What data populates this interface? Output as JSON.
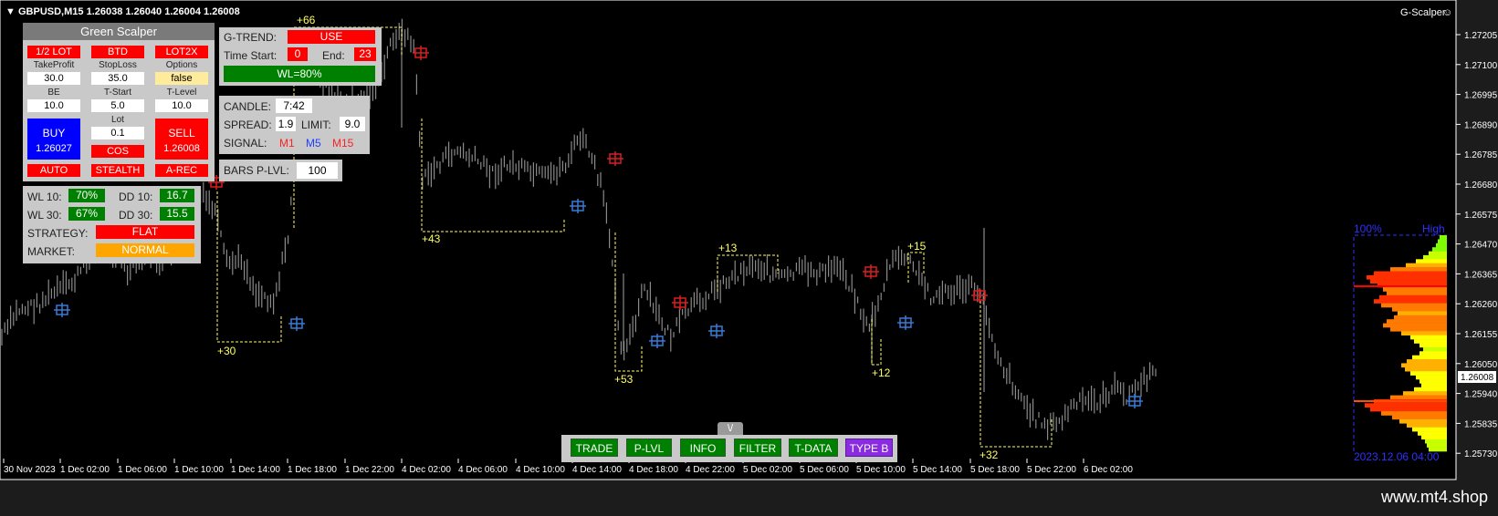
{
  "window": {
    "symbol_line": "GBPUSD,M15  1.26038 1.26040 1.26004 1.26008",
    "indicator_name": "G-Scalper",
    "watermark": "www.mt4.shop",
    "colors": {
      "background": "#000000",
      "candles": "#8a8a8a",
      "profit_text": "#ffff60",
      "buy_marker": "#3a7bd5",
      "sell_marker": "#d82020"
    }
  },
  "price_axis": {
    "labels": [
      "1.27205",
      "1.27100",
      "1.26995",
      "1.26890",
      "1.26785",
      "1.26680",
      "1.26575",
      "1.26470",
      "1.26365",
      "1.26260",
      "1.26155",
      "1.26050",
      "1.25940",
      "1.25835",
      "1.25730"
    ],
    "current_price": "1.26008"
  },
  "time_axis": {
    "labels": [
      "30 Nov 2023",
      "1 Dec 02:00",
      "1 Dec 06:00",
      "1 Dec 10:00",
      "1 Dec 14:00",
      "1 Dec 18:00",
      "1 Dec 22:00",
      "4 Dec 02:00",
      "4 Dec 06:00",
      "4 Dec 10:00",
      "4 Dec 14:00",
      "4 Dec 18:00",
      "4 Dec 22:00",
      "5 Dec 02:00",
      "5 Dec 06:00",
      "5 Dec 10:00",
      "5 Dec 14:00",
      "5 Dec 18:00",
      "5 Dec 22:00",
      "6 Dec 02:00"
    ]
  },
  "trades": [
    {
      "label": "+66"
    },
    {
      "label": "+30"
    },
    {
      "label": "+43"
    },
    {
      "label": "+53"
    },
    {
      "label": "+13"
    },
    {
      "label": "+12"
    },
    {
      "label": "+15"
    },
    {
      "label": "+32"
    }
  ],
  "volume_profile": {
    "top_label": "100%",
    "high_label": "High",
    "date_label": "2023.12.06 04:00"
  },
  "green_scalper": {
    "title": "Green Scalper",
    "half_lot": "1/2 LOT",
    "btd": "BTD",
    "lot2x": "LOT2X",
    "tp_label": "TakeProfit",
    "tp_value": "30.0",
    "sl_label": "StopLoss",
    "sl_value": "35.0",
    "options_label": "Options",
    "options_value": "false",
    "be_label": "BE",
    "be_value": "10.0",
    "tstart_label": "T-Start",
    "tstart_value": "5.0",
    "tlevel_label": "T-Level",
    "tlevel_value": "10.0",
    "lot_label": "Lot",
    "lot_value": "0.1",
    "buy_label": "BUY",
    "buy_price": "1.26027",
    "sell_label": "SELL",
    "sell_price": "1.26008",
    "cos": "COS",
    "auto": "AUTO",
    "stealth": "STEALTH",
    "arec": "A-REC"
  },
  "stats": {
    "wl10_label": "WL 10:",
    "wl10_value": "70%",
    "dd10_label": "DD 10:",
    "dd10_value": "16.7",
    "wl30_label": "WL 30:",
    "wl30_value": "67%",
    "dd30_label": "DD 30:",
    "dd30_value": "15.5",
    "strategy_label": "STRATEGY:",
    "strategy_value": "FLAT",
    "market_label": "MARKET:",
    "market_value": "NORMAL"
  },
  "gtrend": {
    "label": "G-TREND:",
    "value": "USE",
    "time_start_label": "Time Start:",
    "time_start_value": "0",
    "end_label": "End:",
    "end_value": "23",
    "wl": "WL=80%"
  },
  "candle_info": {
    "candle_label": "CANDLE:",
    "candle_value": "7:42",
    "spread_label": "SPREAD:",
    "spread_value": "1.9",
    "limit_label": "LIMIT:",
    "limit_value": "9.0",
    "signal_label": "SIGNAL:",
    "m1": "M1",
    "m5": "M5",
    "m15": "M15"
  },
  "bars_plvl": {
    "label": "BARS P-LVL:",
    "value": "100"
  },
  "bottom_bar": {
    "toggle": "\\/",
    "buttons": [
      "TRADE",
      "P-LVL",
      "INFO",
      "FILTER",
      "T-DATA",
      "TYPE B"
    ]
  }
}
